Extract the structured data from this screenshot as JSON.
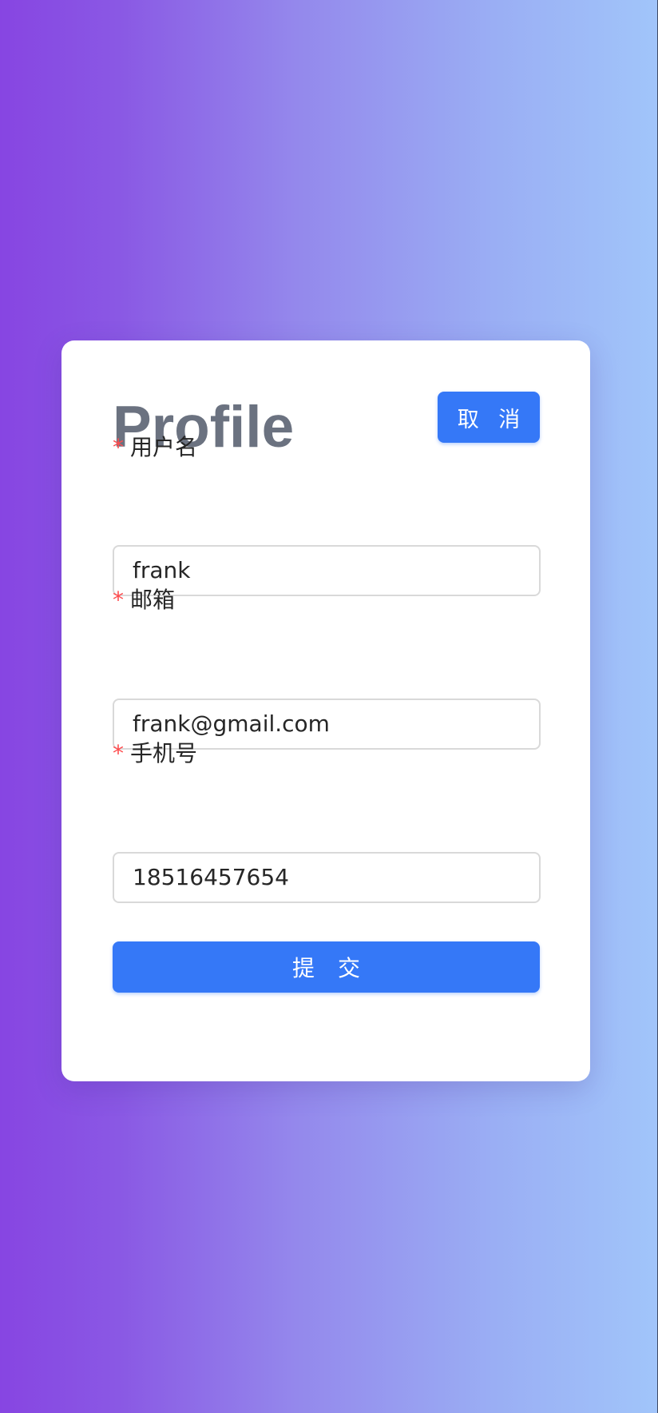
{
  "profile": {
    "title": "Profile",
    "cancel_label": "取 消",
    "submit_label": "提 交",
    "required_marker": "*",
    "fields": [
      {
        "label": "用户名",
        "value": "frank"
      },
      {
        "label": "邮箱",
        "value": "frank@gmail.com"
      },
      {
        "label": "手机号",
        "value": "18516457654"
      }
    ]
  },
  "colors": {
    "primary": "#3578f7",
    "title": "#6b7280",
    "required": "#ff4d4f",
    "gradient_start": "#8745e2",
    "gradient_end": "#a1c5fa"
  }
}
